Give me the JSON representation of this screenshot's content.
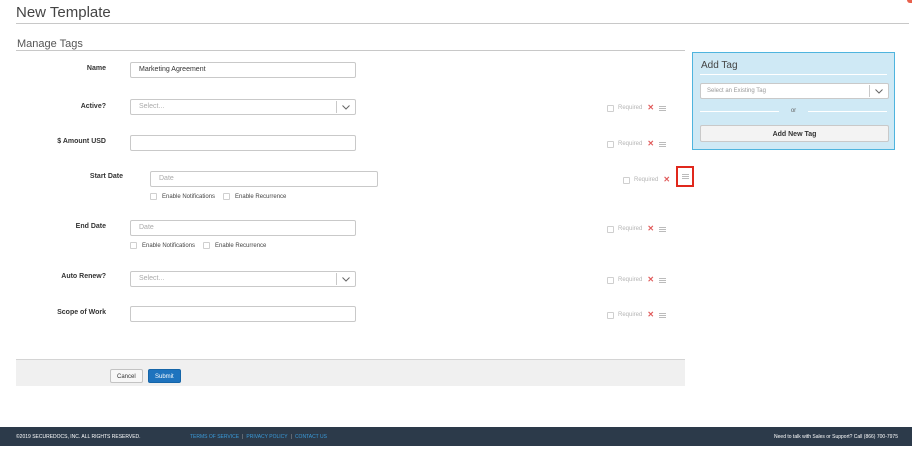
{
  "page": {
    "title": "New Template"
  },
  "section": {
    "title": "Manage Tags"
  },
  "fields": [
    {
      "label": "Name",
      "value": "Marketing Agreement",
      "placeholder": "",
      "required_label": ""
    },
    {
      "label": "Active?",
      "value": "",
      "placeholder": "Select...",
      "required_label": "Required"
    },
    {
      "label": "$ Amount USD",
      "value": "",
      "placeholder": "",
      "required_label": "Required"
    },
    {
      "label": "Start Date",
      "value": "",
      "placeholder": "Date",
      "required_label": "Required",
      "options": [
        "Enable Notifications",
        "Enable Recurrence"
      ]
    },
    {
      "label": "End Date",
      "value": "",
      "placeholder": "Date",
      "required_label": "Required",
      "options": [
        "Enable Notifications",
        "Enable Recurrence"
      ]
    },
    {
      "label": "Auto Renew?",
      "value": "",
      "placeholder": "Select...",
      "required_label": "Required"
    },
    {
      "label": "Scope of Work",
      "value": "",
      "placeholder": "",
      "required_label": "Required"
    }
  ],
  "actions": {
    "cancel_label": "Cancel",
    "submit_label": "Submit"
  },
  "add_tag": {
    "title": "Add Tag",
    "select_placeholder": "Select an Existing Tag",
    "divider_text": "or",
    "add_new_label": "Add New Tag"
  },
  "footer": {
    "copyright": "©2019 SECUREDOCS, INC. ALL RIGHTS RESERVED.",
    "links": [
      "TERMS OF SERVICE",
      "PRIVACY POLICY",
      "CONTACT US"
    ],
    "help": "Need to talk with Sales or Support? Call (866) 700-7975"
  },
  "colors": {
    "accent": "#1e73be",
    "panel_bg": "#cfe9f5",
    "panel_border": "#4eb4de",
    "highlight": "#e0281c",
    "footer_bg": "#2c3a4a"
  },
  "icons": {
    "remove": "x-icon",
    "drag": "drag-handle-icon",
    "dropdown": "chevron-down-icon"
  }
}
